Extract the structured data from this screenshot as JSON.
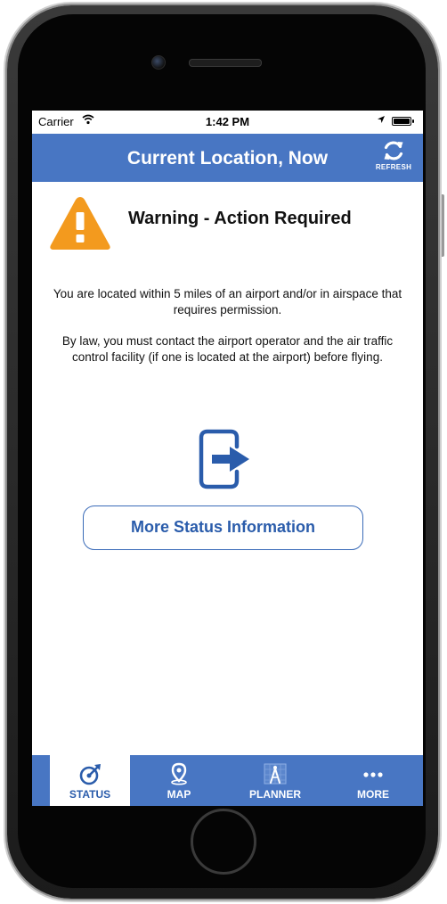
{
  "status_bar": {
    "carrier": "Carrier",
    "time": "1:42 PM"
  },
  "nav": {
    "title": "Current Location, Now",
    "refresh_label": "REFRESH",
    "refresh_icon": "refresh-icon"
  },
  "warning": {
    "icon": "warning-triangle-icon",
    "color": "#f39a1e",
    "title": "Warning - Action Required",
    "message_1": "You are located within 5 miles of an airport and/or in airspace that requires permission.",
    "message_2": "By law, you must contact the airport operator and the air traffic control facility (if one is located at the airport) before flying."
  },
  "more_info": {
    "icon": "exit-arrow-icon",
    "button_label": "More Status Information"
  },
  "tabs": [
    {
      "label": "STATUS",
      "icon": "compass-drone-icon",
      "active": true
    },
    {
      "label": "MAP",
      "icon": "map-pin-icon",
      "active": false
    },
    {
      "label": "PLANNER",
      "icon": "drafting-compass-icon",
      "active": false
    },
    {
      "label": "MORE",
      "icon": "ellipsis-icon",
      "active": false
    }
  ],
  "colors": {
    "accent": "#4876c3",
    "button_text": "#2a5cab",
    "warning": "#f39a1e"
  }
}
